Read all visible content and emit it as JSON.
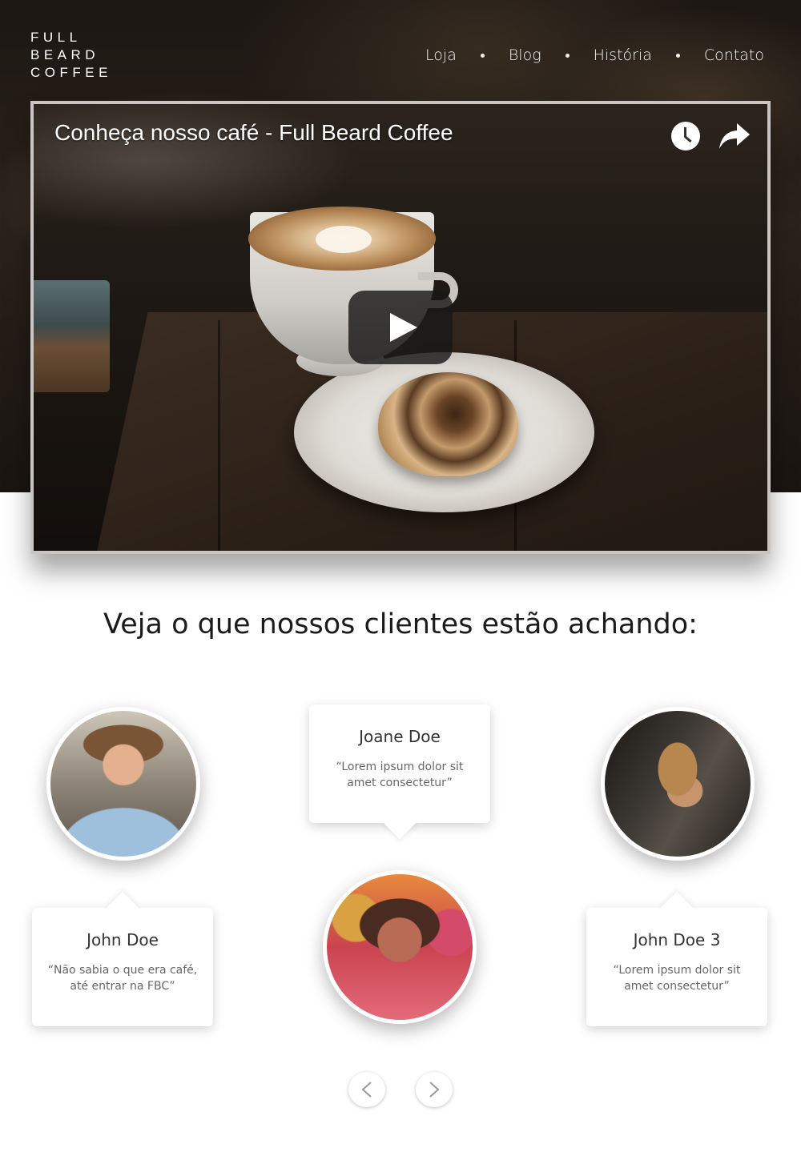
{
  "brand": {
    "logo_lines": [
      "FULL",
      "BEARD",
      "COFFEE"
    ]
  },
  "nav": {
    "items": [
      {
        "label": "Loja"
      },
      {
        "label": "Blog"
      },
      {
        "label": "História"
      },
      {
        "label": "Contato"
      }
    ]
  },
  "video": {
    "title": "Conheça nosso café - Full Beard Coffee",
    "icons": [
      "clock-icon",
      "share-icon",
      "play-icon"
    ]
  },
  "testimonials": {
    "heading": "Veja o que nossos clientes estão achando:",
    "items": [
      {
        "name": "John Doe",
        "quote": "“Não sabia o que era café, até entrar na FBC”"
      },
      {
        "name": "Joane Doe",
        "quote": "“Lorem ipsum dolor sit amet consectetur”"
      },
      {
        "name": "John Doe 3",
        "quote": "“Lorem ipsum dolor sit amet consectetur”"
      }
    ],
    "controls": [
      "chevron-left-icon",
      "chevron-right-icon"
    ]
  },
  "colors": {
    "hero_dark": "#1c1713",
    "text_dark": "#1b1b1b",
    "quote_gray": "#666666",
    "card_bg": "#ffffff"
  }
}
